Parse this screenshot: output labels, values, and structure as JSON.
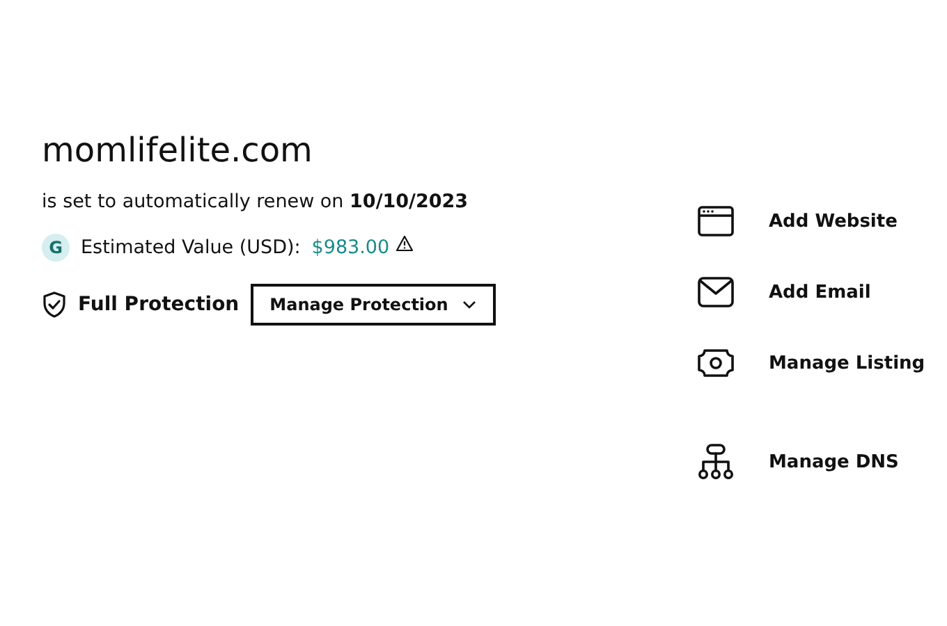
{
  "domain": "momlifelite.com",
  "renewal": "is set to automatically renew on **10/10/2023**",
  "estimate": {
    "avatar": "G",
    "label": "Estimated Value (USD):",
    "value": "$983.00"
  },
  "protection": {
    "label": "Full Protection",
    "button": "Manage Protection"
  },
  "actions": [
    {
      "kind": "website",
      "label": "Add Website"
    },
    {
      "kind": "email",
      "label": "Add Email"
    },
    {
      "kind": "listing",
      "label": "Manage Listing"
    },
    {
      "kind": "dns",
      "label": "Manage DNS"
    }
  ]
}
